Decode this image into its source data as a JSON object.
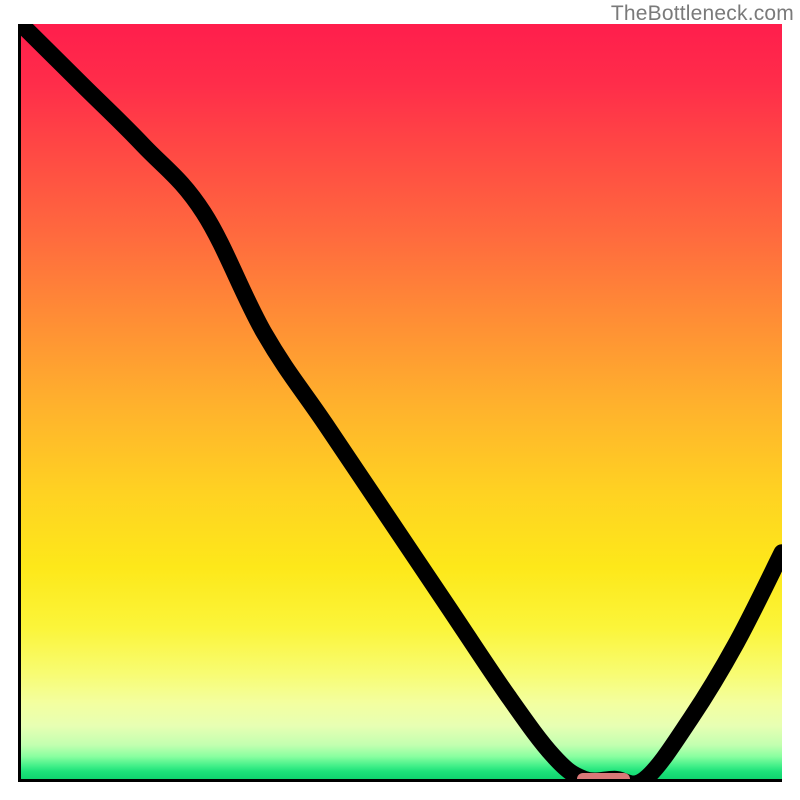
{
  "watermark": "TheBottleneck.com",
  "chart_data": {
    "type": "line",
    "title": "",
    "xlabel": "",
    "ylabel": "",
    "xlim": [
      0,
      100
    ],
    "ylim": [
      0,
      100
    ],
    "grid": false,
    "legend": false,
    "background": "red-yellow-green vertical gradient",
    "series": [
      {
        "name": "bottleneck-curve",
        "x": [
          0,
          8,
          16,
          24,
          32,
          40,
          48,
          56,
          64,
          70,
          74,
          78,
          82,
          88,
          94,
          100
        ],
        "y": [
          100,
          92,
          84,
          75,
          59,
          47,
          35,
          23,
          11,
          3,
          0,
          0,
          0,
          8,
          18,
          30
        ]
      }
    ],
    "marker": {
      "name": "optimal-range",
      "x_start": 73,
      "x_end": 80,
      "y": 0,
      "color": "#d97878"
    }
  }
}
